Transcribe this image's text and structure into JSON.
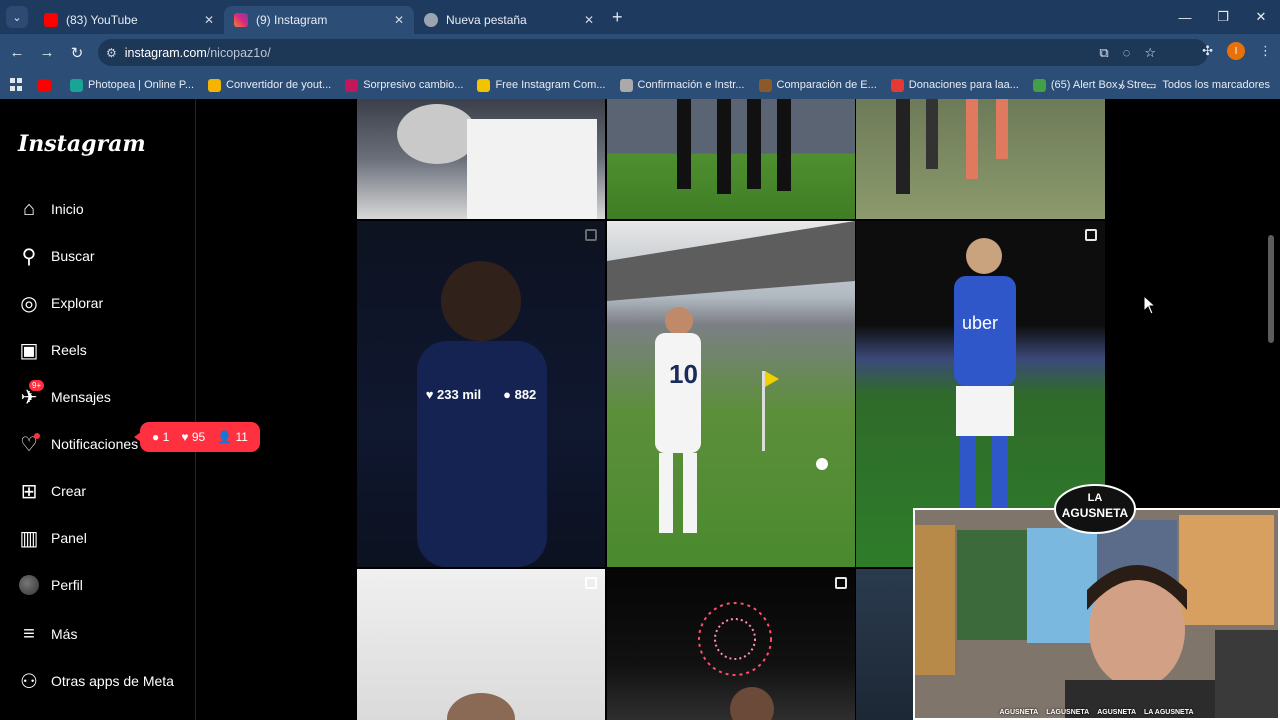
{
  "browser": {
    "tabs": [
      {
        "title": "(83) YouTube",
        "color": "#ff0000"
      },
      {
        "title": "(9) Instagram",
        "color": "#d6249f"
      },
      {
        "title": "Nueva pestaña",
        "color": "#9aa5b1"
      }
    ],
    "url_host": "instagram.com",
    "url_path": "/nicopaz1o/",
    "profile_initial": "I",
    "bookmarks": [
      {
        "label": "",
        "color": "#ff0000"
      },
      {
        "label": "Photopea | Online P...",
        "color": "#18a497"
      },
      {
        "label": "Convertidor de yout...",
        "color": "#f5b400"
      },
      {
        "label": "Sorpresivo cambio...",
        "color": "#c2185b"
      },
      {
        "label": "Free Instagram Com...",
        "color": "#f2c400"
      },
      {
        "label": "Confirmación e Instr...",
        "color": "#aaaaaa"
      },
      {
        "label": "Comparación de E...",
        "color": "#8b5a2b"
      },
      {
        "label": "Donaciones para laa...",
        "color": "#e53935"
      },
      {
        "label": "(65) Alert Box / Stre...",
        "color": "#43a047"
      }
    ],
    "bookmarks_more": "»",
    "all_bookmarks": "Todos los marcadores"
  },
  "instagram": {
    "logo": "Instagram",
    "nav": [
      {
        "label": "Inicio",
        "icon": "home-icon"
      },
      {
        "label": "Buscar",
        "icon": "search-icon"
      },
      {
        "label": "Explorar",
        "icon": "compass-icon"
      },
      {
        "label": "Reels",
        "icon": "reels-icon"
      },
      {
        "label": "Mensajes",
        "icon": "messenger-icon"
      },
      {
        "label": "Notificaciones",
        "icon": "heart-icon"
      },
      {
        "label": "Crear",
        "icon": "plus-square-icon"
      },
      {
        "label": "Panel",
        "icon": "dashboard-icon"
      },
      {
        "label": "Perfil",
        "icon": "avatar"
      },
      {
        "label": "Más",
        "icon": "menu-icon"
      },
      {
        "label": "Otras apps de Meta",
        "icon": "meta-apps-icon"
      }
    ],
    "messages_badge": "9+",
    "notif_pill": {
      "comments": "1",
      "likes": "95",
      "follows": "11"
    },
    "hover_post": {
      "likes": "233 mil",
      "comments": "882"
    }
  },
  "stream": {
    "logo_line1": "LA",
    "logo_line2": "AGUSNETA",
    "footer": [
      "AGUSNETA",
      "LAGUSNETA",
      "AGUSNETA",
      "LA AGUSNETA"
    ]
  }
}
